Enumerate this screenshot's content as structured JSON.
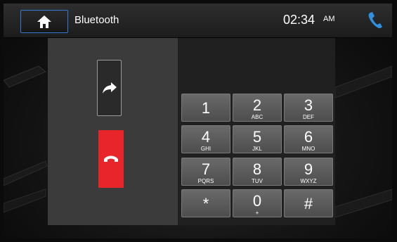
{
  "header": {
    "home_icon": "home-icon",
    "title": "Bluetooth",
    "time": "02:34",
    "ampm": "AM",
    "phone_icon": "phone-icon"
  },
  "call_controls": {
    "transfer_icon": "share-arrow-icon",
    "hangup_icon": "hang-up-icon"
  },
  "keypad": {
    "keys": [
      {
        "digit": "1",
        "letters": ""
      },
      {
        "digit": "2",
        "letters": "ABC"
      },
      {
        "digit": "3",
        "letters": "DEF"
      },
      {
        "digit": "4",
        "letters": "GHI"
      },
      {
        "digit": "5",
        "letters": "JKL"
      },
      {
        "digit": "6",
        "letters": "MNO"
      },
      {
        "digit": "7",
        "letters": "PQRS"
      },
      {
        "digit": "8",
        "letters": "TUV"
      },
      {
        "digit": "9",
        "letters": "WXYZ"
      },
      {
        "digit": "*",
        "letters": ""
      },
      {
        "digit": "0",
        "letters": "+"
      },
      {
        "digit": "#",
        "letters": ""
      }
    ]
  },
  "colors": {
    "accent_blue": "#2f7bd6",
    "hangup_red": "#e8252a",
    "key_gray": "#5a5a5a"
  }
}
